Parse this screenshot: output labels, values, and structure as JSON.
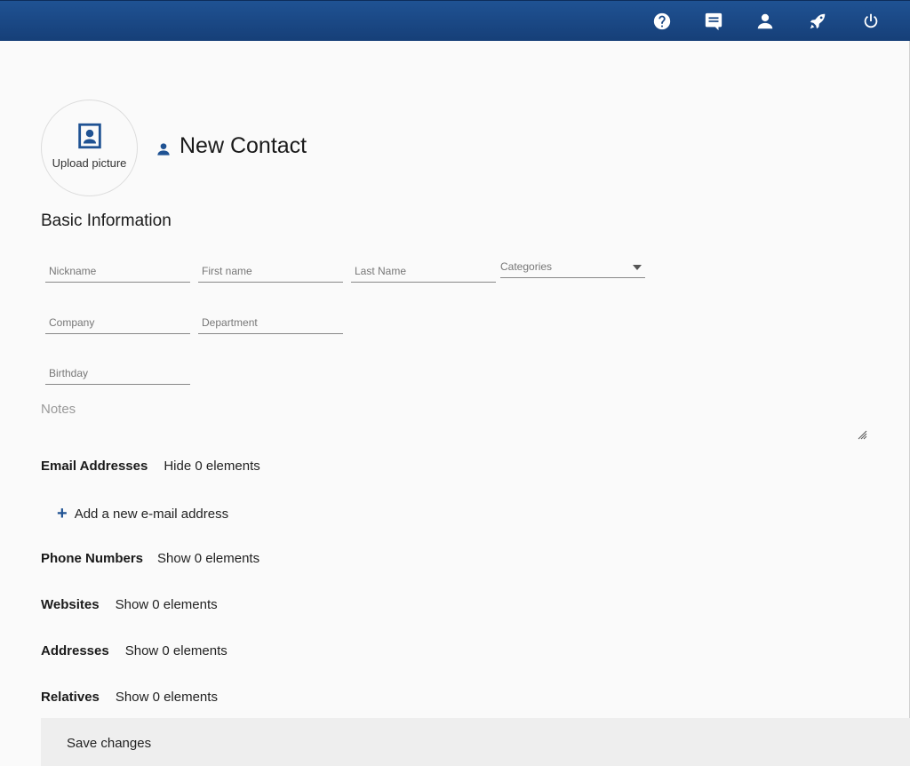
{
  "topbar": {
    "icons": [
      "help-icon",
      "chat-icon",
      "user-icon",
      "rocket-icon",
      "power-icon"
    ]
  },
  "avatar": {
    "label": "Upload picture"
  },
  "title": "New Contact",
  "basic": {
    "heading": "Basic Information",
    "nickname_placeholder": "Nickname",
    "firstname_placeholder": "First name",
    "lastname_placeholder": "Last Name",
    "categories_label": "Categories",
    "company_placeholder": "Company",
    "department_placeholder": "Department",
    "birthday_placeholder": "Birthday",
    "notes_placeholder": "Notes"
  },
  "sections": {
    "email": {
      "heading": "Email Addresses",
      "action": "Hide 0 elements",
      "add": "Add a new e-mail address"
    },
    "phone": {
      "heading": "Phone Numbers",
      "action": "Show 0 elements"
    },
    "websites": {
      "heading": "Websites",
      "action": "Show 0 elements"
    },
    "addresses": {
      "heading": "Addresses",
      "action": "Show 0 elements"
    },
    "relatives": {
      "heading": "Relatives",
      "action": "Show 0 elements"
    }
  },
  "save_label": "Save changes",
  "colors": {
    "header": "#1f5293",
    "accent": "#1f5293"
  }
}
